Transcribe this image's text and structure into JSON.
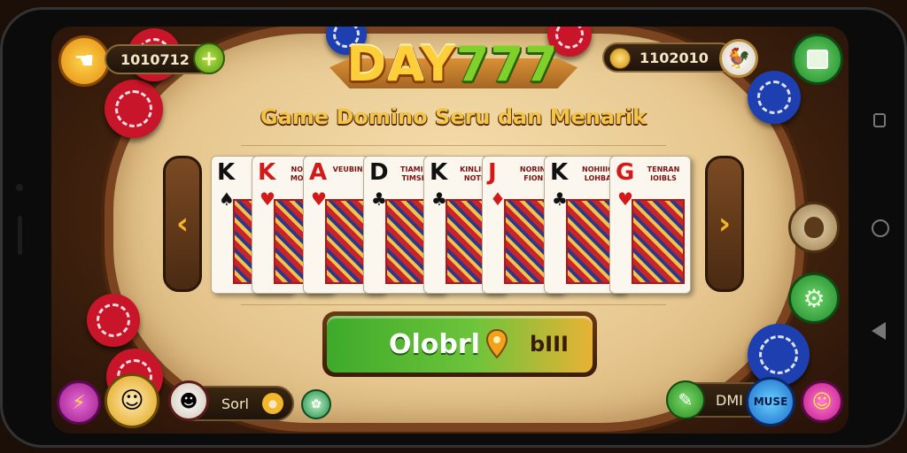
{
  "header": {
    "logo_text": "DAY",
    "logo_number": "777",
    "subtitle": "Game Domino Seru dan Menarik",
    "left_balance": "1010712",
    "right_coins": "1102010"
  },
  "cards": [
    {
      "rank": "K",
      "suit": "♠",
      "caption": "K",
      "suit_color": "black"
    },
    {
      "rank": "K",
      "suit": "♥",
      "caption": "NOHIIO MOHHA",
      "suit_color": "red"
    },
    {
      "rank": "A",
      "suit": "♥",
      "caption": "VEUBIN 9YG",
      "suit_color": "red"
    },
    {
      "rank": "D",
      "suit": "♣",
      "caption": "TIAMIRA TIMSHA",
      "suit_color": "black"
    },
    {
      "rank": "K",
      "suit": "♣",
      "caption": "KINLIINA NOTES",
      "suit_color": "black"
    },
    {
      "rank": "J",
      "suit": "♦",
      "caption": "NORINO FIONE",
      "suit_color": "red"
    },
    {
      "rank": "K",
      "suit": "♣",
      "caption": "NOHIIIO LOHBA",
      "suit_color": "black"
    },
    {
      "rank": "G",
      "suit": "♥",
      "caption": "TENRAN IOIBLS",
      "suit_color": "red"
    }
  ],
  "play_button": {
    "label": "Olobrl",
    "secondary": "bIII"
  },
  "bottom_left": {
    "player_label": "Sorl"
  },
  "bottom_right": {
    "label_a": "DMI",
    "label_b": "MUSE"
  },
  "icons": {
    "menu_left": "hand-pointer-icon",
    "add": "plus-icon",
    "coin": "coin-icon",
    "profile": "rooster-avatar-icon",
    "mission": "list-board-icon",
    "shop": "money-bag-icon",
    "settings": "gear-icon",
    "tools": "wrench-icon",
    "emoji": "smiley-icon"
  },
  "colors": {
    "accent_gold": "#f4b629",
    "play_green": "#3eaa2a",
    "felt": "#f5dfad",
    "wood": "#7a4420"
  }
}
